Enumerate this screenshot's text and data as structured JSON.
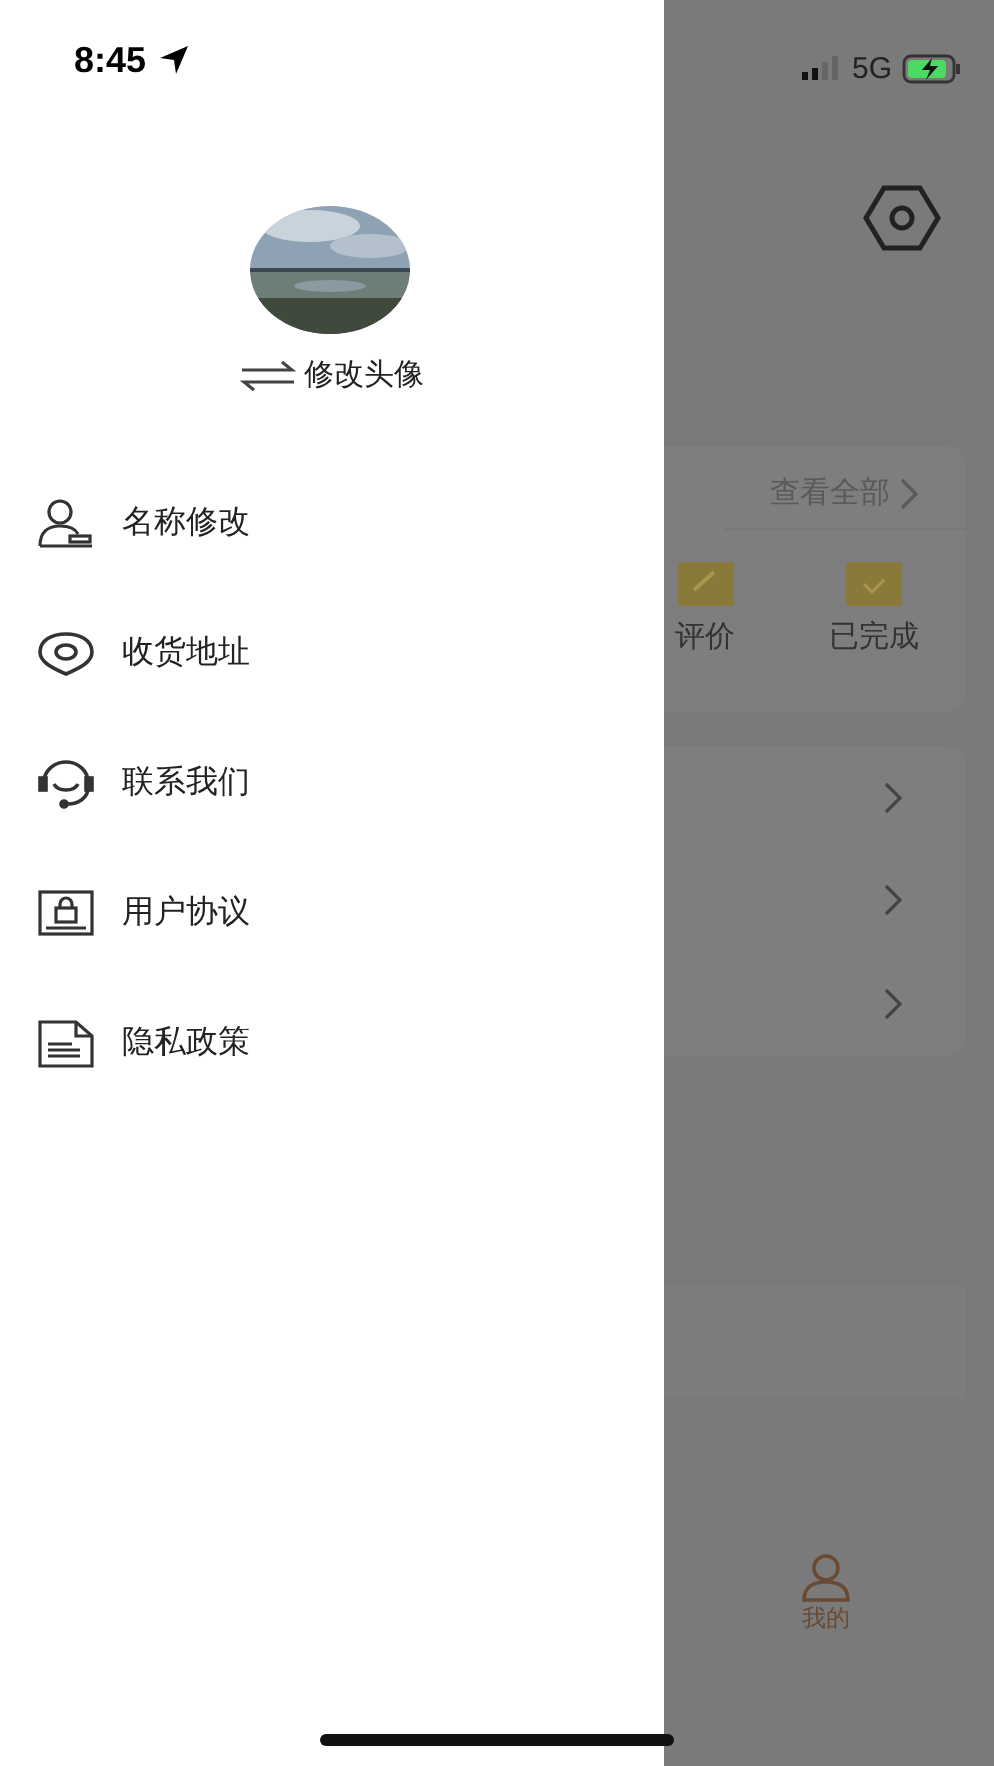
{
  "status_bar": {
    "time": "8:45",
    "network": "5G"
  },
  "drawer": {
    "avatar_caption": "修改头像",
    "menu": [
      {
        "label": "名称修改",
        "kind": "user"
      },
      {
        "label": "收货地址",
        "kind": "location"
      },
      {
        "label": "联系我们",
        "kind": "headset"
      },
      {
        "label": "用户协议",
        "kind": "lock"
      },
      {
        "label": "隐私政策",
        "kind": "document"
      }
    ]
  },
  "background_page": {
    "orders": {
      "view_all": "查看全部",
      "statuses": [
        {
          "label": "评价",
          "kind": "review"
        },
        {
          "label": "已完成",
          "kind": "done"
        }
      ]
    },
    "tab_bar": [
      {
        "label": "我的",
        "selected": true
      }
    ]
  }
}
